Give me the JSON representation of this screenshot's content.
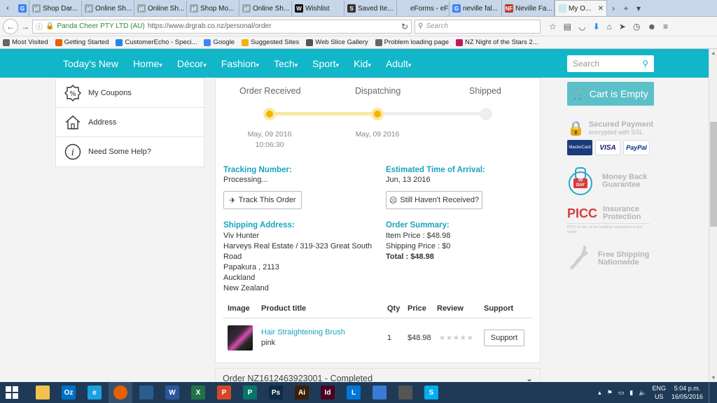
{
  "browser": {
    "tabs": [
      {
        "label": "",
        "favicon": "G",
        "color": "#4285f4"
      },
      {
        "label": "Shop Dar...",
        "favicon": "jd",
        "color": "#9aa7b5"
      },
      {
        "label": "Online Sh...",
        "favicon": "jd",
        "color": "#9aa7b5"
      },
      {
        "label": "Online Sh...",
        "favicon": "jd",
        "color": "#9aa7b5"
      },
      {
        "label": "Shop Mo...",
        "favicon": "jd",
        "color": "#9aa7b5"
      },
      {
        "label": "Online Sh...",
        "favicon": "jd",
        "color": "#9aa7b5"
      },
      {
        "label": "Wishlist",
        "favicon": "W",
        "color": "#111111"
      },
      {
        "label": "Saved Ite...",
        "favicon": "S",
        "color": "#333333"
      },
      {
        "label": "eForms - eFor...",
        "favicon": "",
        "color": "#c7d6e8"
      },
      {
        "label": "neville fal...",
        "favicon": "G",
        "color": "#4285f4"
      },
      {
        "label": "Neville Fa...",
        "favicon": "NF",
        "color": "#c0392b"
      },
      {
        "label": "My O...",
        "favicon": "",
        "color": "#cfe8ef"
      }
    ],
    "identity": "Panda Cheer PTY LTD (AU)",
    "url": "https://www.drgrab.co.nz/personal/order",
    "search_placeholder": "Search",
    "bookmarks": [
      {
        "label": "Most Visited",
        "color": "#666666"
      },
      {
        "label": "Getting Started",
        "color": "#e66000"
      },
      {
        "label": "CustomerEcho - Speci...",
        "color": "#1e88e5"
      },
      {
        "label": "Google",
        "color": "#4285f4"
      },
      {
        "label": "Suggested Sites",
        "color": "#f0b400"
      },
      {
        "label": "Web Slice Gallery",
        "color": "#555555"
      },
      {
        "label": "Problem loading page",
        "color": "#666666"
      },
      {
        "label": "NZ Night of the Stars 2...",
        "color": "#c2185b"
      }
    ]
  },
  "site": {
    "menu": [
      "Today's New",
      "Home",
      "Décor",
      "Fashion",
      "Tech",
      "Sport",
      "Kid",
      "Adult"
    ],
    "search_placeholder": "Search",
    "accent": "#11b6c8"
  },
  "sidebar": {
    "items": [
      {
        "label": "My Coupons",
        "icon": "coupon-icon"
      },
      {
        "label": "Address",
        "icon": "house-icon"
      },
      {
        "label": "Need Some Help?",
        "icon": "info-icon"
      }
    ]
  },
  "order": {
    "steps": [
      {
        "label": "Order Received",
        "date": "May, 09 2016",
        "time": "10:06:30",
        "done": true
      },
      {
        "label": "Dispatching",
        "date": "May, 09 2016",
        "time": "",
        "done": true
      },
      {
        "label": "Shipped",
        "date": "",
        "time": "",
        "done": false
      }
    ],
    "tracking_title": "Tracking Number:",
    "tracking_value": "Processing...",
    "track_button": "Track This Order",
    "eta_title": "Estimated Time of Arrival:",
    "eta_value": "Jun, 13 2016",
    "not_received_button": "Still Haven't Received?",
    "shipping_title": "Shipping Address:",
    "shipping_lines": [
      "Viv Hunter",
      "Harveys Real Estate / 319-323 Great South",
      "Road",
      "Papakura , 2113",
      "Auckland",
      "New Zealand"
    ],
    "summary_title": "Order Summary:",
    "item_price": "Item Price : $48.98",
    "shipping_price": "Shipping Price : $0",
    "total": "Total : $48.98",
    "table_headers": [
      "Image",
      "Product title",
      "Qty",
      "Price",
      "Review",
      "Support"
    ],
    "product": {
      "title": "Hair Straightening Brush",
      "variant": "pink",
      "qty": "1",
      "price": "$48.98",
      "support": "Support"
    }
  },
  "order2": {
    "label": "Order NZ1612463923001 - Completed"
  },
  "right": {
    "cart": "Cart is Empty",
    "secure": "Secured Payment",
    "secure_sub": "encrypted with SSL",
    "cards": [
      "MasterCard",
      "VISA",
      "PayPal"
    ],
    "moneyback": [
      "Money Back",
      "Guarantee"
    ],
    "moneyback_days": [
      "30",
      "DAY"
    ],
    "picc": "PICC",
    "insurance": [
      "Insurance",
      "Protection"
    ],
    "picc_note": "PICC is one of the leading companies in the world.",
    "freeship": [
      "Free Shipping",
      "Nationwide"
    ]
  },
  "taskbar": {
    "apps": [
      {
        "name": "explorer-app",
        "glyph": "",
        "color": "#f2c14e"
      },
      {
        "name": "outlook-app",
        "glyph": "Oz",
        "color": "#0072c6"
      },
      {
        "name": "ie-app",
        "glyph": "e",
        "color": "#1ba1e2"
      },
      {
        "name": "firefox-app",
        "glyph": "",
        "color": "#e66000"
      },
      {
        "name": "app-blue",
        "glyph": "",
        "color": "#2a5d8f"
      },
      {
        "name": "word-app",
        "glyph": "W",
        "color": "#2b579a"
      },
      {
        "name": "excel-app",
        "glyph": "X",
        "color": "#217346"
      },
      {
        "name": "powerpoint-app",
        "glyph": "P",
        "color": "#d24726"
      },
      {
        "name": "publisher-app",
        "glyph": "P",
        "color": "#077568"
      },
      {
        "name": "photoshop-app",
        "glyph": "Ps",
        "color": "#0d2b45"
      },
      {
        "name": "illustrator-app",
        "glyph": "Ai",
        "color": "#3b1f0a"
      },
      {
        "name": "indesign-app",
        "glyph": "Id",
        "color": "#49021f"
      },
      {
        "name": "lync-app",
        "glyph": "L",
        "color": "#0078d7"
      },
      {
        "name": "network-app",
        "glyph": "",
        "color": "#3a7bd5"
      },
      {
        "name": "game-app",
        "glyph": "",
        "color": "#555555"
      },
      {
        "name": "skype-app",
        "glyph": "S",
        "color": "#00aff0"
      }
    ],
    "lang": "ENG",
    "region": "US",
    "time": "5:04 p.m.",
    "date": "16/05/2016"
  }
}
